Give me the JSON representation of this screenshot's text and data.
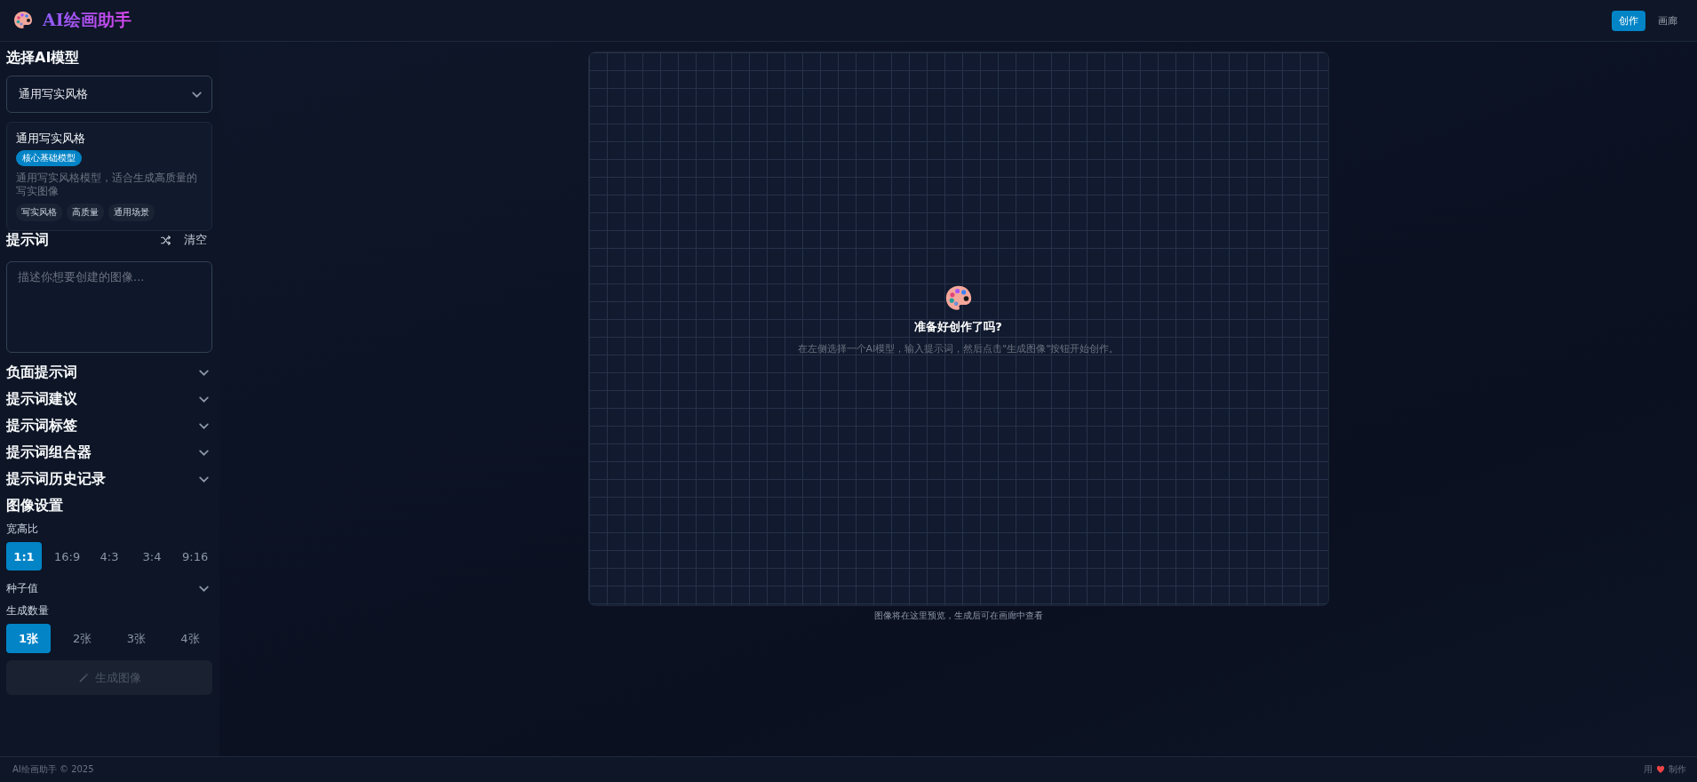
{
  "header": {
    "logo_text": "AI绘画助手",
    "nav": [
      {
        "label": "创作",
        "selected": true
      },
      {
        "label": "画廊",
        "selected": false
      }
    ]
  },
  "sidebar": {
    "model_title": "选择AI模型",
    "model_select": "通用写实风格",
    "model_card": {
      "name": "通用写实风格",
      "badge": "核心基础模型",
      "description": "通用写实风格模型，适合生成高质量的写实图像",
      "tags": [
        "写实风格",
        "高质量",
        "通用场景"
      ]
    },
    "prompt": {
      "title": "提示词",
      "clear_label": "清空",
      "placeholder": "描述你想要创建的图像..."
    },
    "sections": [
      {
        "label": "负面提示词",
        "expanded": false
      },
      {
        "label": "提示词建议",
        "expanded": false
      },
      {
        "label": "提示词标签",
        "expanded": false
      },
      {
        "label": "提示词组合器",
        "expanded": false
      },
      {
        "label": "提示词历史记录",
        "expanded": false
      }
    ],
    "image_settings": {
      "title": "图像设置",
      "aspect_label": "宽高比",
      "aspect_options": [
        {
          "label": "1:1",
          "selected": true
        },
        {
          "label": "16:9",
          "selected": false
        },
        {
          "label": "4:3",
          "selected": false
        },
        {
          "label": "3:4",
          "selected": false
        },
        {
          "label": "9:16",
          "selected": false
        }
      ],
      "seed_label": "种子值",
      "seed_expanded": false,
      "count_label": "生成数量",
      "count_options": [
        {
          "label": "1张",
          "selected": true
        },
        {
          "label": "2张",
          "selected": false
        },
        {
          "label": "3张",
          "selected": false
        },
        {
          "label": "4张",
          "selected": false
        }
      ],
      "generate": {
        "label": "生成图像",
        "disabled": true
      }
    }
  },
  "canvas": {
    "empty_title": "准备好创作了吗?",
    "empty_text": "在左侧选择一个AI模型，输入提示词，然后点击\"生成图像\"按钮开始创作。",
    "caption": "图像将在这里预览，生成后可在画廊中查看"
  },
  "footer": {
    "copyright": "AI绘画助手 © 2025",
    "made_pre": "用",
    "made_post": "制作"
  }
}
